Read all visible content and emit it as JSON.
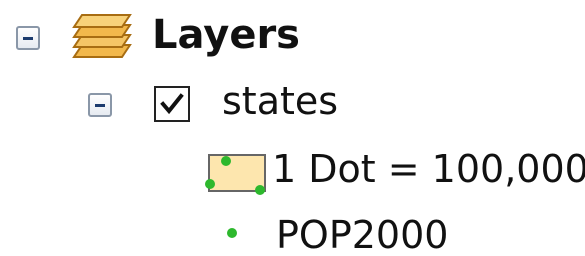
{
  "toc": {
    "root": {
      "label": "Layers",
      "icon": "layers-stack-icon",
      "expanded": true
    },
    "layer": {
      "name": "states",
      "checked": true,
      "expanded": true,
      "legend": {
        "dot_density_label": "1 Dot = 100,000",
        "field_name": "POP2000",
        "dot_color": "#2db82d",
        "swatch_fill": "#fde6ae"
      }
    }
  },
  "colors": {
    "expander_border": "#8a97a8",
    "expander_minus": "#1c3b6e",
    "layers_icon_fill": "#f2b84c",
    "layers_icon_stroke": "#a86d12",
    "text": "#111111"
  }
}
